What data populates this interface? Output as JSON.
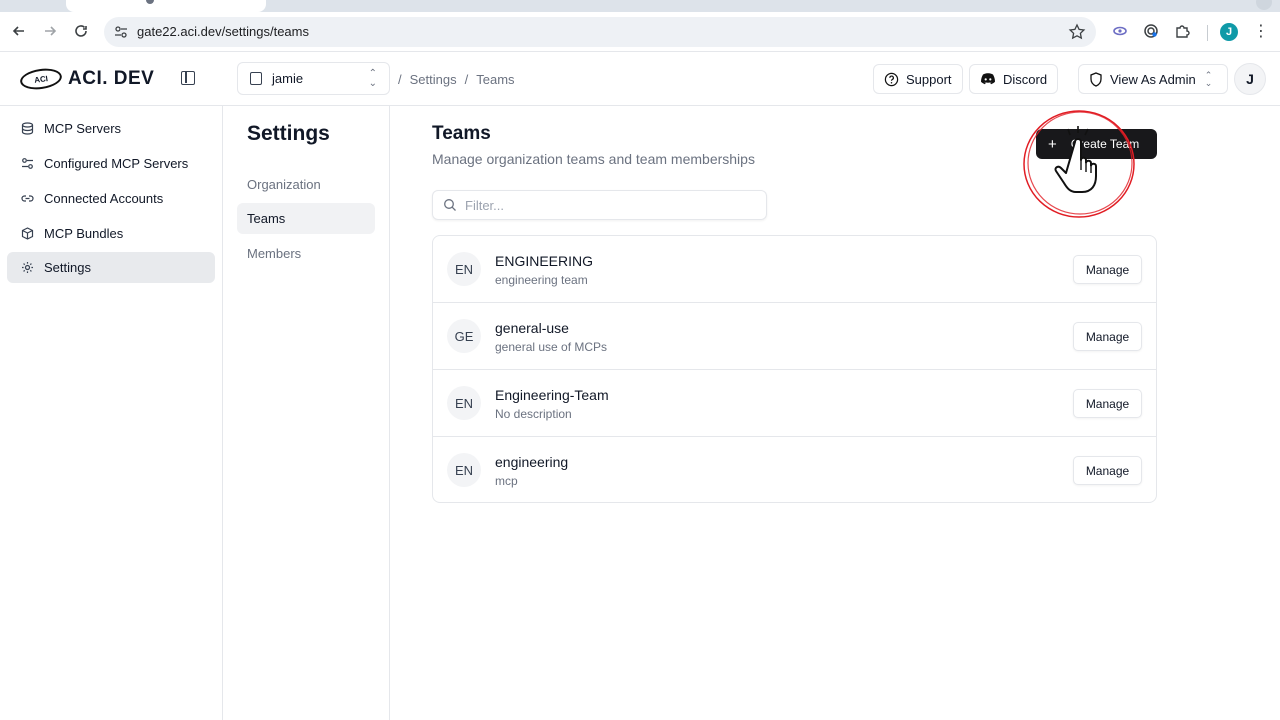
{
  "browser": {
    "url": "gate22.aci.dev/settings/teams",
    "profile_initial": "J"
  },
  "header": {
    "logo_badge": "ACI",
    "logo_text": "ACI. DEV",
    "org": "jamie",
    "breadcrumb": [
      "/",
      "Settings",
      "/",
      "Teams"
    ],
    "support_label": "Support",
    "discord_label": "Discord",
    "role_label": "View As Admin",
    "avatar_initial": "J"
  },
  "sidebar": {
    "items": [
      {
        "label": "MCP Servers",
        "icon": "database-icon"
      },
      {
        "label": "Configured MCP Servers",
        "icon": "sliders-icon"
      },
      {
        "label": "Connected Accounts",
        "icon": "link-icon"
      },
      {
        "label": "MCP Bundles",
        "icon": "package-icon"
      },
      {
        "label": "Settings",
        "icon": "gear-icon",
        "active": true
      }
    ]
  },
  "settings_nav": {
    "title": "Settings",
    "items": [
      {
        "label": "Organization"
      },
      {
        "label": "Teams",
        "active": true
      },
      {
        "label": "Members"
      }
    ]
  },
  "main": {
    "title": "Teams",
    "subtitle": "Manage organization teams and team memberships",
    "create_label": "Create Team",
    "filter_placeholder": "Filter...",
    "manage_label": "Manage",
    "teams": [
      {
        "initials": "EN",
        "name": "ENGINEERING",
        "description": "engineering team"
      },
      {
        "initials": "GE",
        "name": "general-use",
        "description": "general use of MCPs"
      },
      {
        "initials": "EN",
        "name": "Engineering-Team",
        "description": "No description"
      },
      {
        "initials": "EN",
        "name": "engineering",
        "description": "mcp"
      }
    ]
  },
  "colors": {
    "primary_button": "#18181b",
    "cursor_ring": "#e11d24",
    "profile": "#0f9aa8"
  }
}
